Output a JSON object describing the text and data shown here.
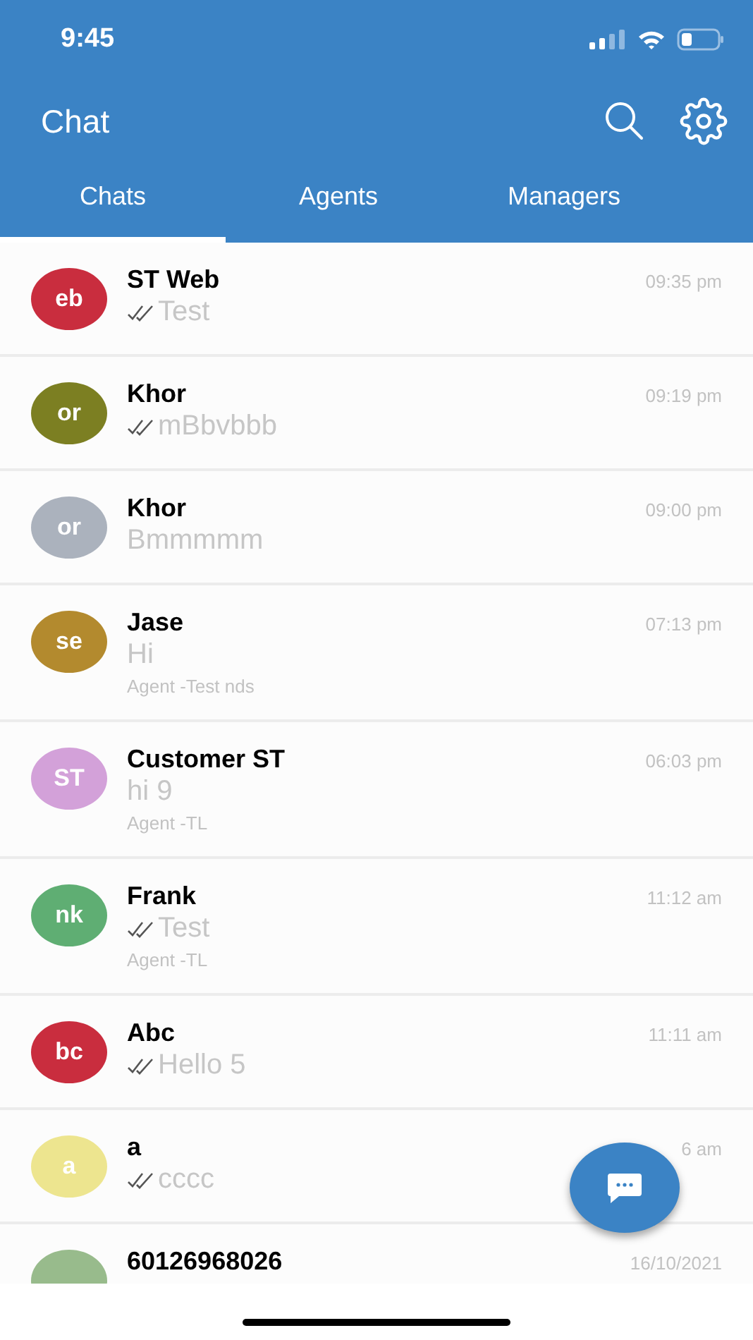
{
  "status_bar": {
    "time": "9:45"
  },
  "header": {
    "title": "Chat"
  },
  "tabs": [
    {
      "label": "Chats",
      "selected": true
    },
    {
      "label": "Agents",
      "selected": false
    },
    {
      "label": "Managers",
      "selected": false
    }
  ],
  "chats": [
    {
      "initials": "eb",
      "color": "#c92d3e",
      "name": "ST Web",
      "time": "09:35 pm",
      "ticked": true,
      "message": "Test"
    },
    {
      "initials": "or",
      "color": "#7c7f22",
      "name": "Khor",
      "time": "09:19 pm",
      "ticked": true,
      "message": "mBbvbbb"
    },
    {
      "initials": "or",
      "color": "#abb2bd",
      "name": "Khor",
      "time": "09:00 pm",
      "ticked": false,
      "message": "Bmmmmm"
    },
    {
      "initials": "se",
      "color": "#b38a2e",
      "name": "Jase",
      "time": "07:13 pm",
      "ticked": false,
      "message": "Hi",
      "agent": "Agent -Test nds"
    },
    {
      "initials": "ST",
      "color": "#d3a1d9",
      "name": "Customer ST",
      "time": "06:03 pm",
      "ticked": false,
      "message": "hi 9",
      "agent": "Agent -TL"
    },
    {
      "initials": "nk",
      "color": "#5fae73",
      "name": "Frank",
      "time": "11:12 am",
      "ticked": true,
      "message": "Test",
      "agent": "Agent -TL"
    },
    {
      "initials": "bc",
      "color": "#c92d3e",
      "name": "Abc",
      "time": "11:11 am",
      "ticked": true,
      "message": "Hello 5"
    },
    {
      "initials": "a",
      "color": "#ede58f",
      "name": "a",
      "time": "6 am",
      "ticked": true,
      "message": "cccc"
    },
    {
      "color": "#98bb8c",
      "name": "60126968026",
      "time": "16/10/2021",
      "ticked": false
    }
  ]
}
